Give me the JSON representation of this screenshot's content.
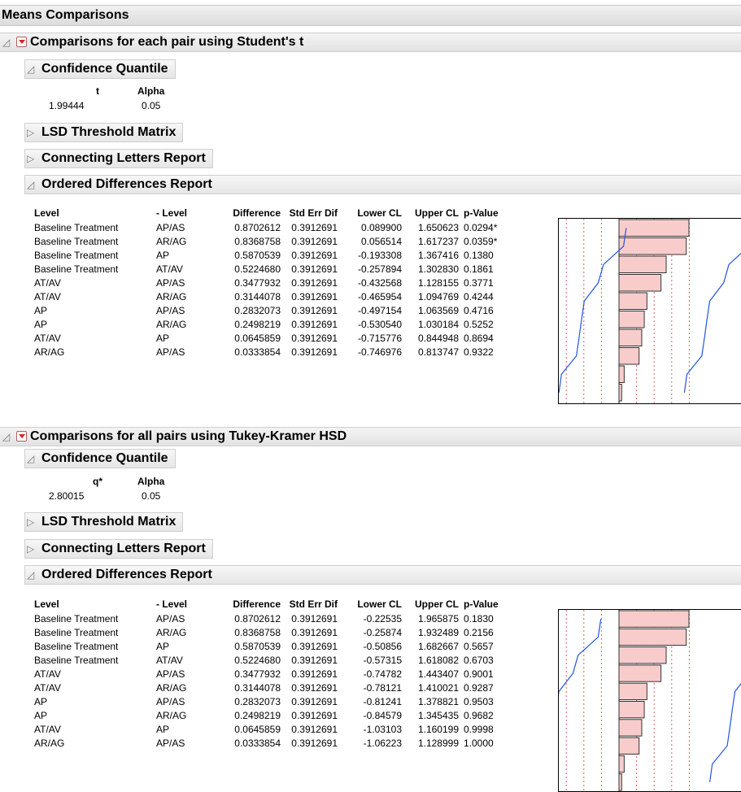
{
  "main_title": "Means Comparisons",
  "sections": [
    {
      "title": "Comparisons for each pair using Student's t",
      "cq_title": "Confidence Quantile",
      "cq_headers": [
        "t",
        "Alpha"
      ],
      "cq_values": [
        "1.99444",
        "0.05"
      ],
      "lsd_title": "LSD Threshold Matrix",
      "clr_title": "Connecting Letters Report",
      "odr_title": "Ordered Differences Report",
      "headers": [
        "Level",
        "- Level",
        "Difference",
        "Std Err Dif",
        "Lower CL",
        "Upper CL",
        "p-Value"
      ],
      "rows": [
        [
          "Baseline Treatment",
          "AP/AS",
          "0.8702612",
          "0.3912691",
          "0.089900",
          "1.650623",
          "0.0294*"
        ],
        [
          "Baseline Treatment",
          "AR/AG",
          "0.8368758",
          "0.3912691",
          "0.056514",
          "1.617237",
          "0.0359*"
        ],
        [
          "Baseline Treatment",
          "AP",
          "0.5870539",
          "0.3912691",
          "-0.193308",
          "1.367416",
          "0.1380"
        ],
        [
          "Baseline Treatment",
          "AT/AV",
          "0.5224680",
          "0.3912691",
          "-0.257894",
          "1.302830",
          "0.1861"
        ],
        [
          "AT/AV",
          "AP/AS",
          "0.3477932",
          "0.3912691",
          "-0.432568",
          "1.128155",
          "0.3771"
        ],
        [
          "AT/AV",
          "AR/AG",
          "0.3144078",
          "0.3912691",
          "-0.465954",
          "1.094769",
          "0.4244"
        ],
        [
          "AP",
          "AP/AS",
          "0.2832073",
          "0.3912691",
          "-0.497154",
          "1.063569",
          "0.4716"
        ],
        [
          "AP",
          "AR/AG",
          "0.2498219",
          "0.3912691",
          "-0.530540",
          "1.030184",
          "0.5252"
        ],
        [
          "AT/AV",
          "AP",
          "0.0645859",
          "0.3912691",
          "-0.715776",
          "0.844948",
          "0.8694"
        ],
        [
          "AR/AG",
          "AP/AS",
          "0.0333854",
          "0.3912691",
          "-0.746976",
          "0.813747",
          "0.9322"
        ]
      ]
    },
    {
      "title": "Comparisons for all pairs using Tukey-Kramer HSD",
      "cq_title": "Confidence Quantile",
      "cq_headers": [
        "q*",
        "Alpha"
      ],
      "cq_values": [
        "2.80015",
        "0.05"
      ],
      "lsd_title": "LSD Threshold Matrix",
      "clr_title": "Connecting Letters Report",
      "odr_title": "Ordered Differences Report",
      "headers": [
        "Level",
        "- Level",
        "Difference",
        "Std Err Dif",
        "Lower CL",
        "Upper CL",
        "p-Value"
      ],
      "rows": [
        [
          "Baseline Treatment",
          "AP/AS",
          "0.8702612",
          "0.3912691",
          "-0.22535",
          "1.965875",
          "0.1830"
        ],
        [
          "Baseline Treatment",
          "AR/AG",
          "0.8368758",
          "0.3912691",
          "-0.25874",
          "1.932489",
          "0.2156"
        ],
        [
          "Baseline Treatment",
          "AP",
          "0.5870539",
          "0.3912691",
          "-0.50856",
          "1.682667",
          "0.5657"
        ],
        [
          "Baseline Treatment",
          "AT/AV",
          "0.5224680",
          "0.3912691",
          "-0.57315",
          "1.618082",
          "0.6703"
        ],
        [
          "AT/AV",
          "AP/AS",
          "0.3477932",
          "0.3912691",
          "-0.74782",
          "1.443407",
          "0.9001"
        ],
        [
          "AT/AV",
          "AR/AG",
          "0.3144078",
          "0.3912691",
          "-0.78121",
          "1.410021",
          "0.9287"
        ],
        [
          "AP",
          "AP/AS",
          "0.2832073",
          "0.3912691",
          "-0.81241",
          "1.378821",
          "0.9503"
        ],
        [
          "AP",
          "AR/AG",
          "0.2498219",
          "0.3912691",
          "-0.84579",
          "1.345435",
          "0.9682"
        ],
        [
          "AT/AV",
          "AP",
          "0.0645859",
          "0.3912691",
          "-1.03103",
          "1.160199",
          "0.9998"
        ],
        [
          "AR/AG",
          "AP/AS",
          "0.0333854",
          "0.3912691",
          "-1.06223",
          "1.128999",
          "1.0000"
        ]
      ]
    }
  ],
  "colors": {
    "bar_fill": "#f9cccc",
    "bar_stroke": "#333333",
    "ci_line": "#2255dd",
    "grid_line": "#e06060",
    "menu_arrow": "#dd2222"
  }
}
